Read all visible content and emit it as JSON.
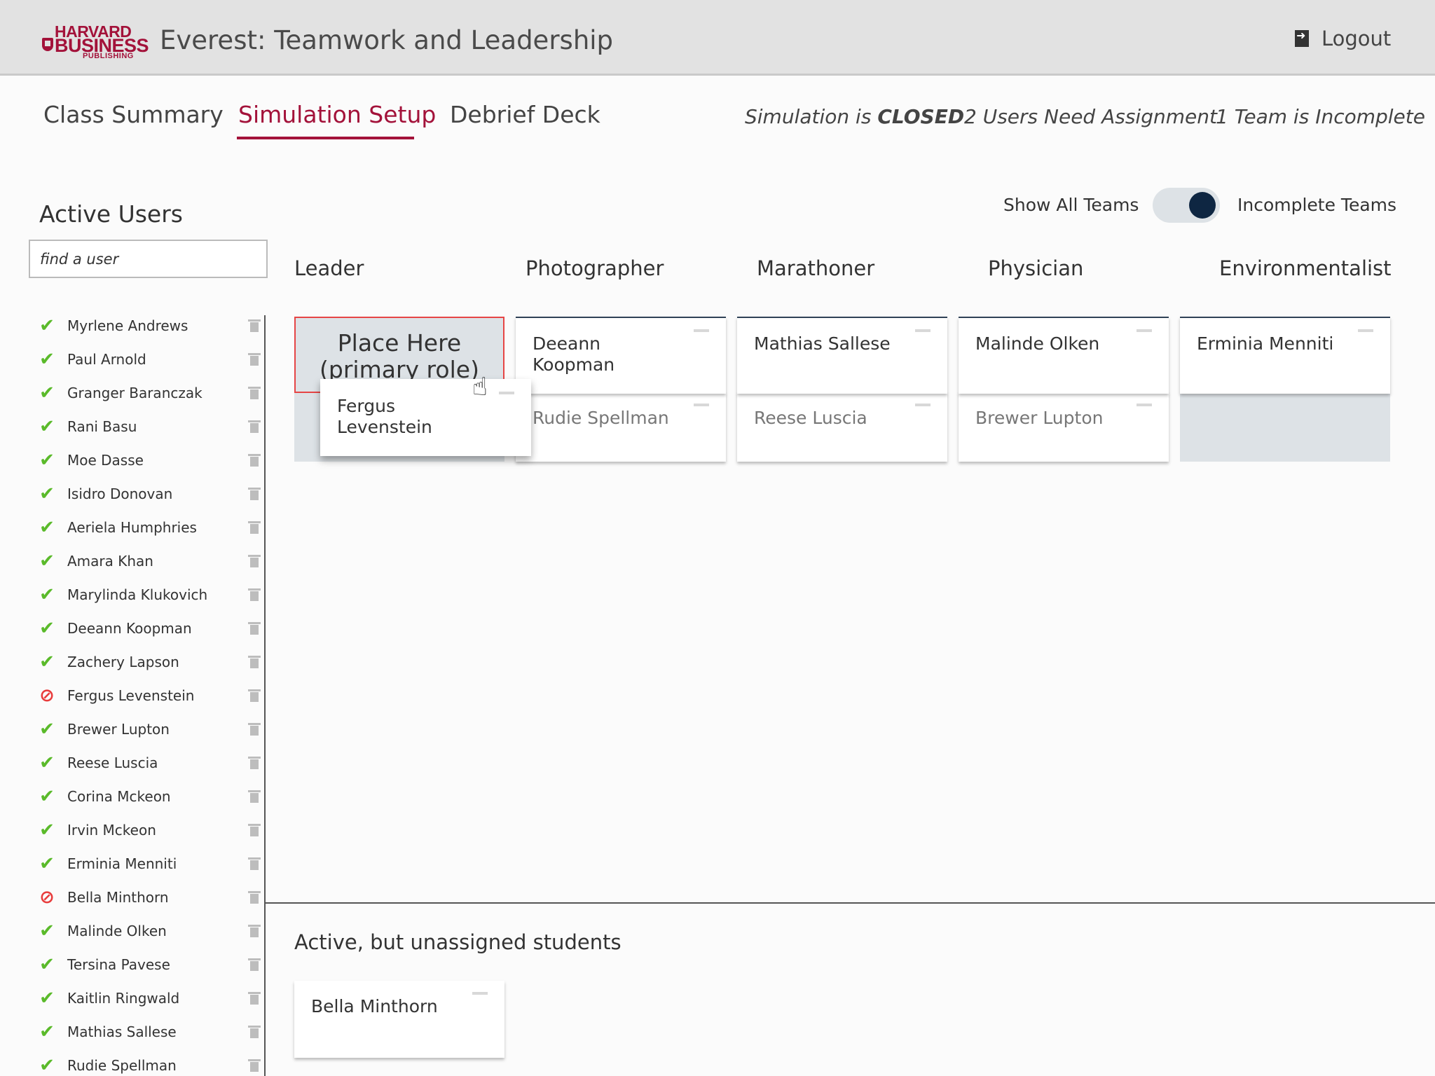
{
  "header": {
    "logo": {
      "line1": "HARVARD",
      "line2": "BUSINESS",
      "line3": "PUBLISHING"
    },
    "title": "Everest: Teamwork and Leadership",
    "logout_label": "Logout"
  },
  "tabs": [
    {
      "label": "Class Summary",
      "active": false
    },
    {
      "label": "Simulation Setup",
      "active": true
    },
    {
      "label": "Debrief Deck",
      "active": false
    }
  ],
  "status": {
    "simulation_prefix": "Simulation is ",
    "simulation_state": "CLOSED",
    "users_need_assignment": "2 Users Need Assignment",
    "team_incomplete": "1 Team is Incomplete"
  },
  "sidebar": {
    "title": "Active Users",
    "search_placeholder": "find a user",
    "users": [
      {
        "name": "Myrlene Andrews",
        "assigned": true
      },
      {
        "name": "Paul Arnold",
        "assigned": true
      },
      {
        "name": "Granger Baranczak",
        "assigned": true
      },
      {
        "name": "Rani Basu",
        "assigned": true
      },
      {
        "name": "Moe Dasse",
        "assigned": true
      },
      {
        "name": "Isidro Donovan",
        "assigned": true
      },
      {
        "name": "Aeriela Humphries",
        "assigned": true
      },
      {
        "name": "Amara Khan",
        "assigned": true
      },
      {
        "name": "Marylinda Klukovich",
        "assigned": true
      },
      {
        "name": "Deeann Koopman",
        "assigned": true
      },
      {
        "name": "Zachery Lapson",
        "assigned": true
      },
      {
        "name": "Fergus Levenstein",
        "assigned": false
      },
      {
        "name": "Brewer Lupton",
        "assigned": true
      },
      {
        "name": "Reese Luscia",
        "assigned": true
      },
      {
        "name": "Corina Mckeon",
        "assigned": true
      },
      {
        "name": "Irvin Mckeon",
        "assigned": true
      },
      {
        "name": "Erminia Menniti",
        "assigned": true
      },
      {
        "name": "Bella Minthorn",
        "assigned": false
      },
      {
        "name": "Malinde Olken",
        "assigned": true
      },
      {
        "name": "Tersina Pavese",
        "assigned": true
      },
      {
        "name": "Kaitlin Ringwald",
        "assigned": true
      },
      {
        "name": "Mathias Sallese",
        "assigned": true
      },
      {
        "name": "Rudie Spellman",
        "assigned": true
      }
    ]
  },
  "toggle": {
    "left_label": "Show All Teams",
    "right_label": "Incomplete Teams"
  },
  "roles": [
    {
      "name": "Leader",
      "primary": "",
      "secondary": ""
    },
    {
      "name": "Photographer",
      "primary": "Deeann Koopman",
      "secondary": "Rudie Spellman"
    },
    {
      "name": "Marathoner",
      "primary": "Mathias Sallese",
      "secondary": "Reese Luscia"
    },
    {
      "name": "Physician",
      "primary": "Malinde Olken",
      "secondary": "Brewer Lupton"
    },
    {
      "name": "Environmentalist",
      "primary": "Erminia Menniti",
      "secondary": ""
    }
  ],
  "placeholder_text": "Place Here (primary role)",
  "dragging_card": "Fergus Levenstein",
  "unassigned": {
    "title": "Active, but unassigned students",
    "students": [
      "Bella Minthorn"
    ]
  },
  "colors": {
    "accent": "#a3123a",
    "check": "#5aba2a",
    "blocked": "#e83c3c",
    "toggle_knob": "#0e2642"
  }
}
